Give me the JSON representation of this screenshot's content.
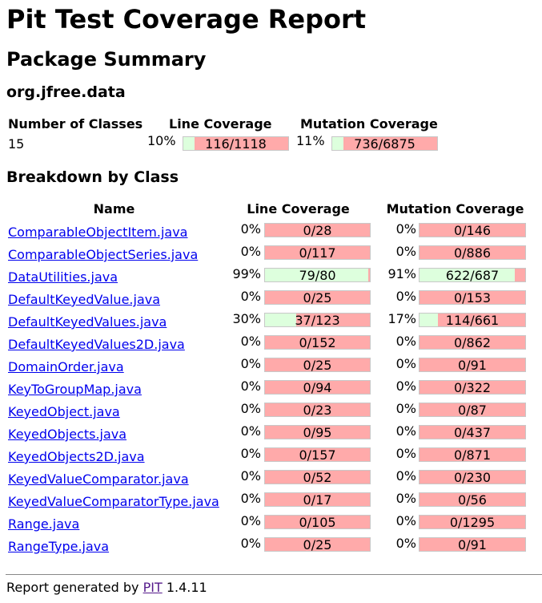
{
  "title": "Pit Test Coverage Report",
  "subtitle": "Package Summary",
  "package_name": "org.jfree.data",
  "summary": {
    "headers": {
      "classes": "Number of Classes",
      "line": "Line Coverage",
      "mutation": "Mutation Coverage"
    },
    "num_classes": "15",
    "line_pct": "10%",
    "line_label": "116/1118",
    "line_fraction": 0.104,
    "mutation_pct": "11%",
    "mutation_label": "736/6875",
    "mutation_fraction": 0.107
  },
  "breakdown_title": "Breakdown by Class",
  "table_headers": {
    "name": "Name",
    "line": "Line Coverage",
    "mutation": "Mutation Coverage"
  },
  "rows": [
    {
      "name": "ComparableObjectItem.java",
      "line_pct": "0%",
      "line_label": "0/28",
      "line_fraction": 0,
      "mut_pct": "0%",
      "mut_label": "0/146",
      "mut_fraction": 0
    },
    {
      "name": "ComparableObjectSeries.java",
      "line_pct": "0%",
      "line_label": "0/117",
      "line_fraction": 0,
      "mut_pct": "0%",
      "mut_label": "0/886",
      "mut_fraction": 0
    },
    {
      "name": "DataUtilities.java",
      "line_pct": "99%",
      "line_label": "79/80",
      "line_fraction": 0.9875,
      "mut_pct": "91%",
      "mut_label": "622/687",
      "mut_fraction": 0.905
    },
    {
      "name": "DefaultKeyedValue.java",
      "line_pct": "0%",
      "line_label": "0/25",
      "line_fraction": 0,
      "mut_pct": "0%",
      "mut_label": "0/153",
      "mut_fraction": 0
    },
    {
      "name": "DefaultKeyedValues.java",
      "line_pct": "30%",
      "line_label": "37/123",
      "line_fraction": 0.301,
      "mut_pct": "17%",
      "mut_label": "114/661",
      "mut_fraction": 0.172
    },
    {
      "name": "DefaultKeyedValues2D.java",
      "line_pct": "0%",
      "line_label": "0/152",
      "line_fraction": 0,
      "mut_pct": "0%",
      "mut_label": "0/862",
      "mut_fraction": 0
    },
    {
      "name": "DomainOrder.java",
      "line_pct": "0%",
      "line_label": "0/25",
      "line_fraction": 0,
      "mut_pct": "0%",
      "mut_label": "0/91",
      "mut_fraction": 0
    },
    {
      "name": "KeyToGroupMap.java",
      "line_pct": "0%",
      "line_label": "0/94",
      "line_fraction": 0,
      "mut_pct": "0%",
      "mut_label": "0/322",
      "mut_fraction": 0
    },
    {
      "name": "KeyedObject.java",
      "line_pct": "0%",
      "line_label": "0/23",
      "line_fraction": 0,
      "mut_pct": "0%",
      "mut_label": "0/87",
      "mut_fraction": 0
    },
    {
      "name": "KeyedObjects.java",
      "line_pct": "0%",
      "line_label": "0/95",
      "line_fraction": 0,
      "mut_pct": "0%",
      "mut_label": "0/437",
      "mut_fraction": 0
    },
    {
      "name": "KeyedObjects2D.java",
      "line_pct": "0%",
      "line_label": "0/157",
      "line_fraction": 0,
      "mut_pct": "0%",
      "mut_label": "0/871",
      "mut_fraction": 0
    },
    {
      "name": "KeyedValueComparator.java",
      "line_pct": "0%",
      "line_label": "0/52",
      "line_fraction": 0,
      "mut_pct": "0%",
      "mut_label": "0/230",
      "mut_fraction": 0
    },
    {
      "name": "KeyedValueComparatorType.java",
      "line_pct": "0%",
      "line_label": "0/17",
      "line_fraction": 0,
      "mut_pct": "0%",
      "mut_label": "0/56",
      "mut_fraction": 0
    },
    {
      "name": "Range.java",
      "line_pct": "0%",
      "line_label": "0/105",
      "line_fraction": 0,
      "mut_pct": "0%",
      "mut_label": "0/1295",
      "mut_fraction": 0
    },
    {
      "name": "RangeType.java",
      "line_pct": "0%",
      "line_label": "0/25",
      "line_fraction": 0,
      "mut_pct": "0%",
      "mut_label": "0/91",
      "mut_fraction": 0
    }
  ],
  "footer": {
    "prefix": "Report generated by",
    "link": "PIT",
    "version": "1.4.11"
  },
  "colors": {
    "covered": "#ddffdd",
    "uncovered": "#ffaaaa",
    "link": "#0000ee",
    "visited_link": "#551a8b"
  }
}
